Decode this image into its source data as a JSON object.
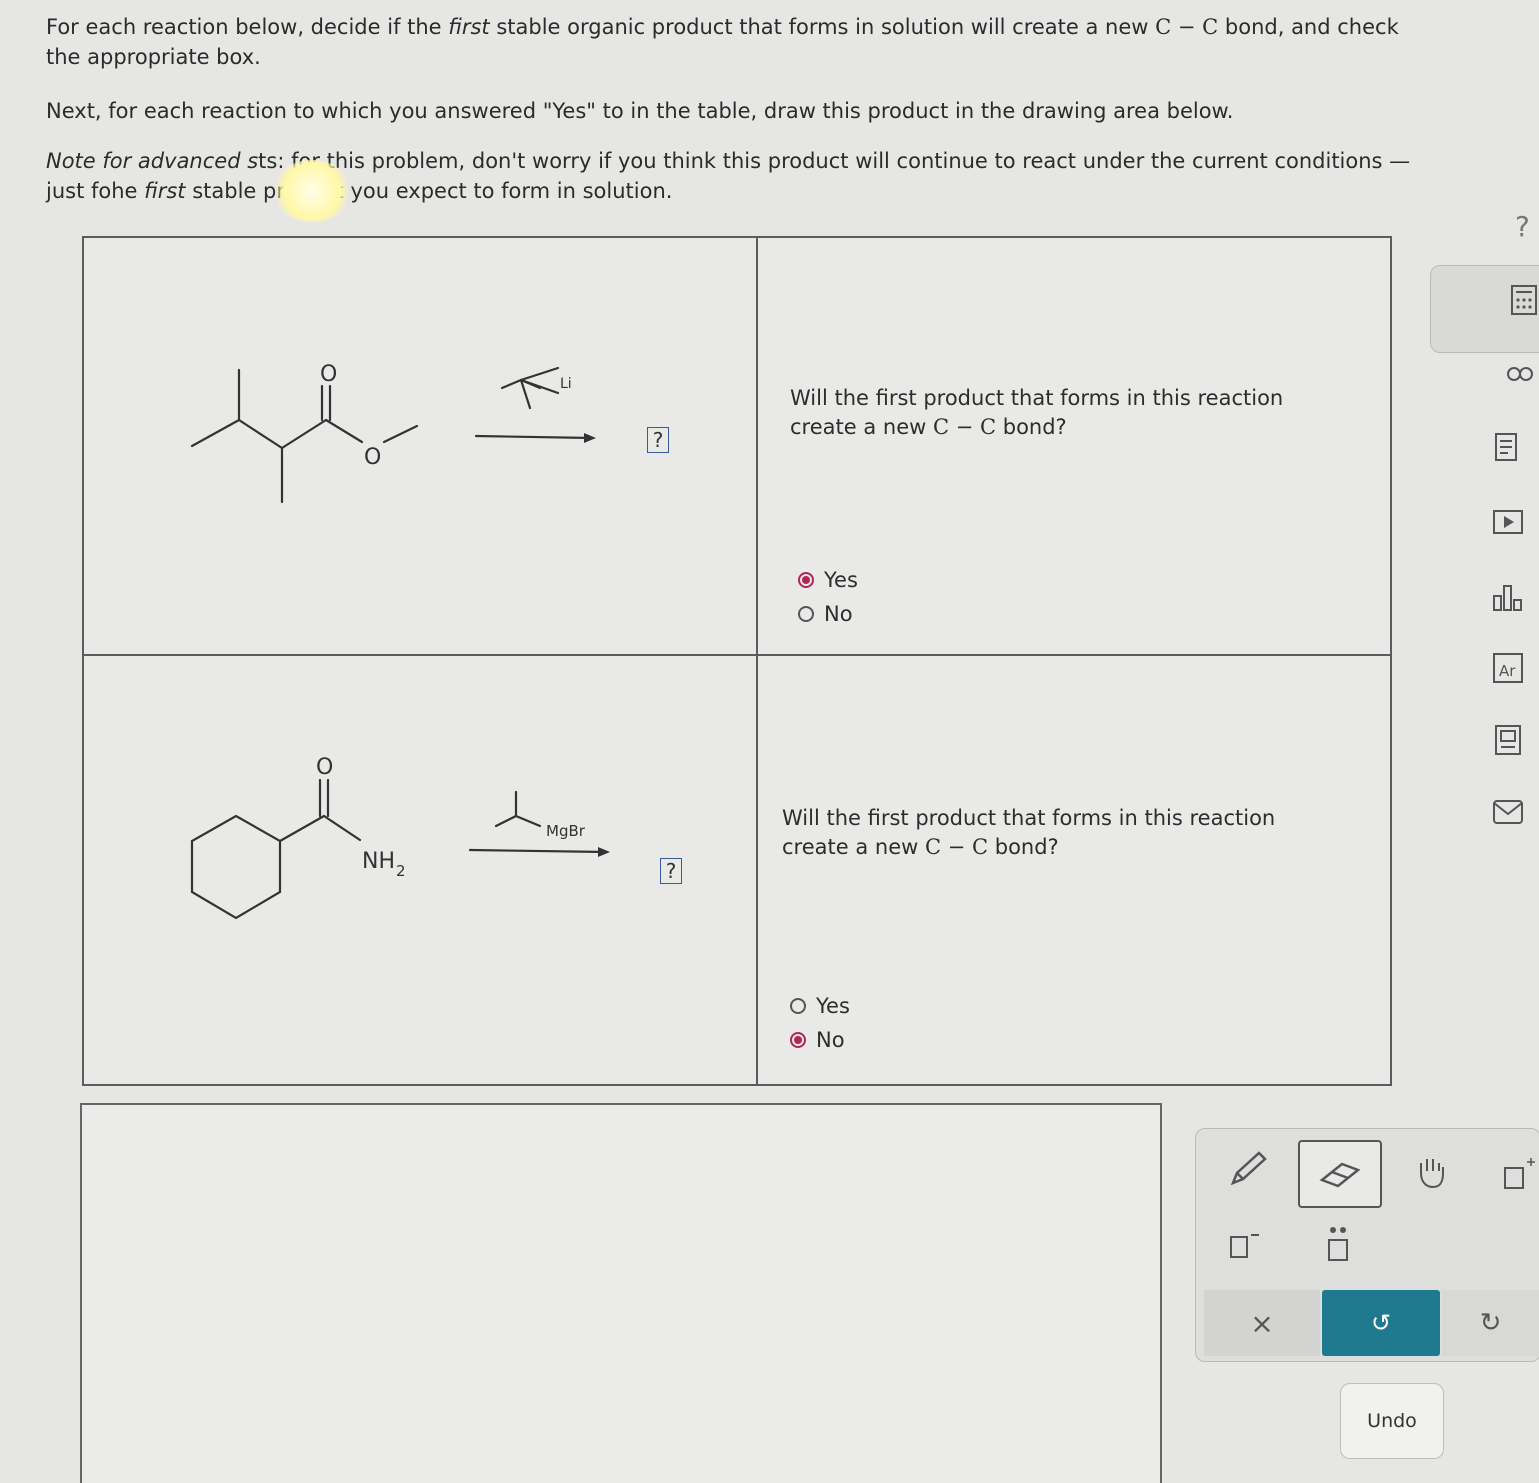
{
  "instructions": {
    "p1_a": "For each reaction below, decide if the ",
    "p1_first": "first",
    "p1_b": " stable organic product that forms in solution will create a new ",
    "p1_cc": "C − C",
    "p1_c": " bond, and check the appropriate box.",
    "p2": "Next, for each reaction to which you answered \"Yes\" to in the table, draw this product in the drawing area below.",
    "p3_note": "Note for advanced s",
    "p3_a": "ts: for this problem, don't worry if you think this product will continue to react under the current conditions — just fo",
    "p3_first": "first",
    "p3_b": " stable product you expect to form in solution.",
    "p3_the": "he "
  },
  "reactions": [
    {
      "reactant_labels": {
        "carbonyl_o": "O",
        "ester_o": "O"
      },
      "reagent_label": "Li",
      "product_placeholder": "?",
      "question_a": "Will the first product that forms in this reaction",
      "question_b": "create a new ",
      "question_cc": "C − C",
      "question_c": " bond?",
      "options": [
        "Yes",
        "No"
      ],
      "selected": "Yes"
    },
    {
      "reactant_labels": {
        "carbonyl_o": "O",
        "amine": "NH",
        "amine_sub": "2"
      },
      "reagent_label": "MgBr",
      "product_placeholder": "?",
      "question_a": "Will the first product that forms in this reaction",
      "question_b": "create a new ",
      "question_cc": "C − C",
      "question_c": " bond?",
      "options": [
        "Yes",
        "No"
      ],
      "selected": "No"
    }
  ],
  "toolbar": {
    "clear_symbol": "×",
    "undo_symbol": "↺",
    "redo_symbol": "↻",
    "undo_tooltip": "Undo"
  },
  "sidebar": {
    "help": "?",
    "icons": [
      "calculator-icon",
      "infinity-icon",
      "notes-icon",
      "play-icon",
      "chart-icon",
      "periodic-table-icon",
      "data-icon",
      "mail-icon"
    ]
  },
  "colors": {
    "selected_radio": "#b0245a",
    "undo_button": "#1f7a8f",
    "placeholder_border": "#3a5a9a"
  }
}
